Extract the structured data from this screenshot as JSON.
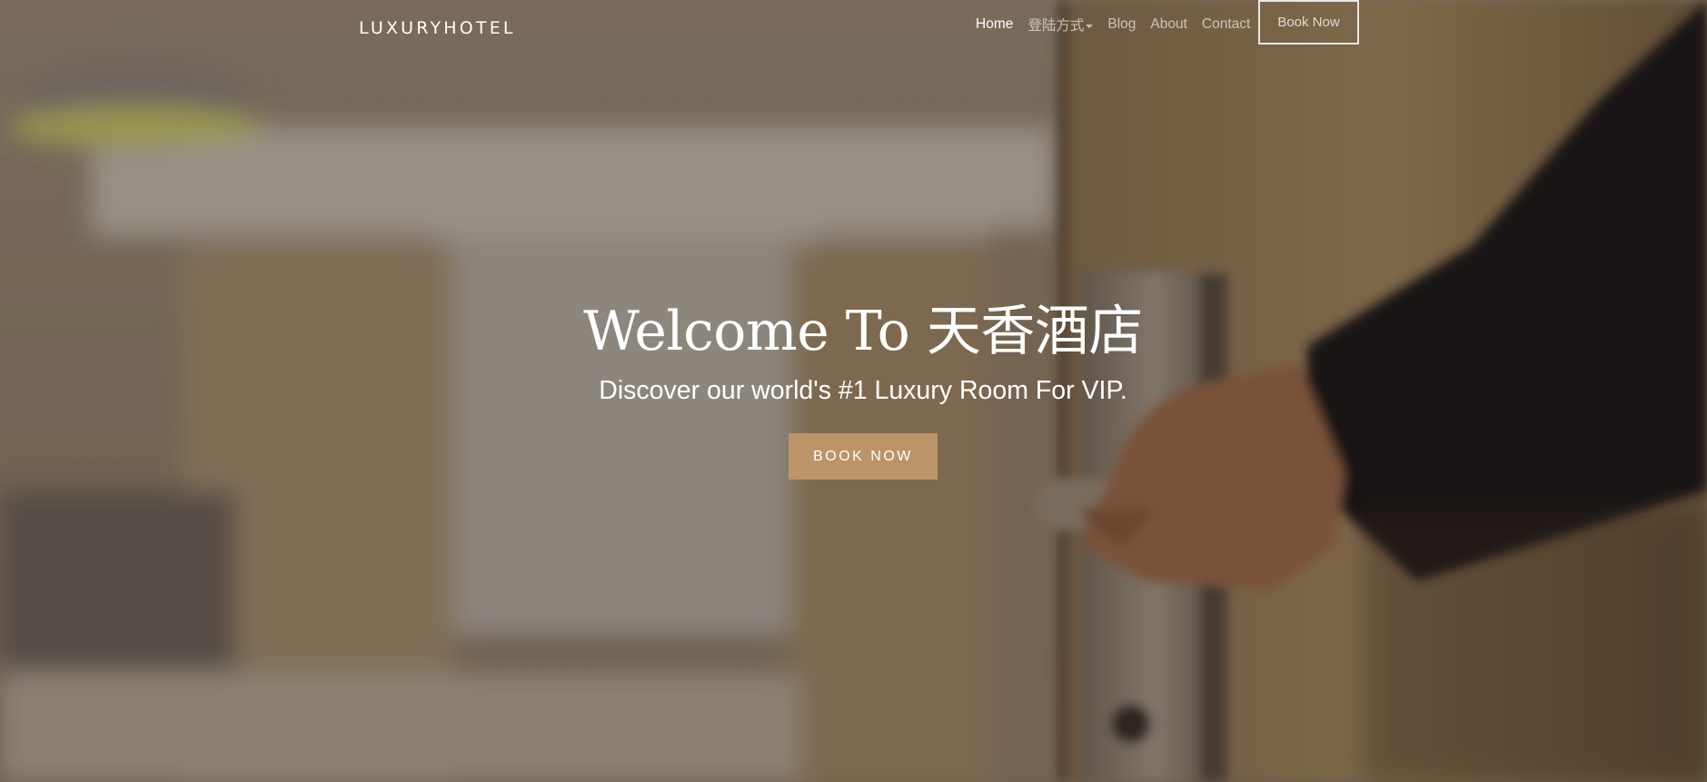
{
  "brand": {
    "name": "LUXURYHOTEL"
  },
  "nav": {
    "items": [
      {
        "label": "Home",
        "active": true
      },
      {
        "label": "登陆方式",
        "dropdown": true
      },
      {
        "label": "Blog"
      },
      {
        "label": "About"
      },
      {
        "label": "Contact"
      }
    ],
    "book_label": "Book Now"
  },
  "hero": {
    "title": "Welcome To 天香酒店",
    "subtitle": "Discover our world's #1 Luxury Room For VIP.",
    "cta_label": "BOOK NOW"
  },
  "colors": {
    "accent": "#bb9467",
    "text": "#ffffff",
    "nav_muted": "rgba(255,255,255,0.62)"
  }
}
